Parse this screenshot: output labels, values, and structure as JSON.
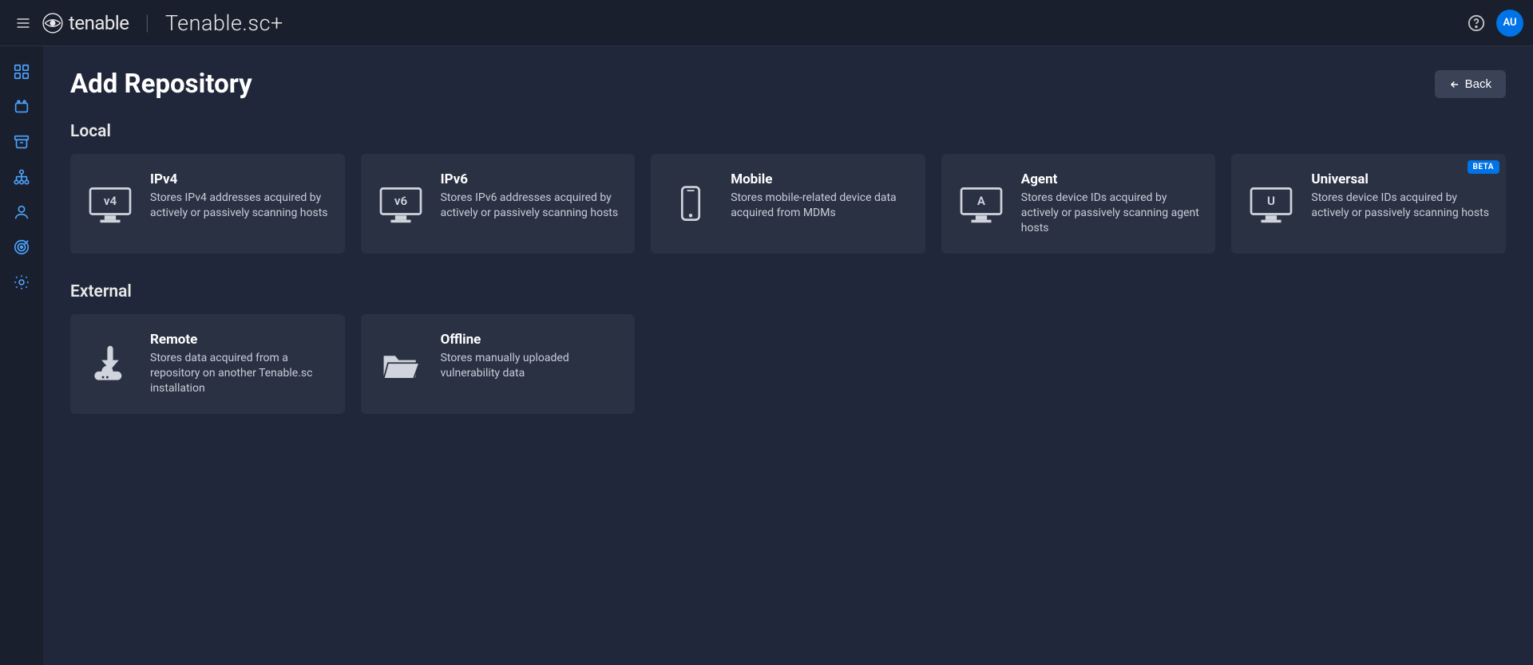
{
  "header": {
    "brand_name": "tenable",
    "product_name": "Tenable.sc+",
    "avatar_initials": "AU"
  },
  "page": {
    "title": "Add Repository",
    "back_label": "Back"
  },
  "sections": {
    "local": {
      "title": "Local",
      "cards": [
        {
          "icon_label": "v4",
          "title": "IPv4",
          "desc": "Stores IPv4 addresses acquired by actively or passively scanning hosts"
        },
        {
          "icon_label": "v6",
          "title": "IPv6",
          "desc": "Stores IPv6 addresses acquired by actively or passively scanning hosts"
        },
        {
          "icon_label": "",
          "title": "Mobile",
          "desc": "Stores mobile-related device data acquired from MDMs"
        },
        {
          "icon_label": "A",
          "title": "Agent",
          "desc": "Stores device IDs acquired by actively or passively scanning agent hosts"
        },
        {
          "icon_label": "U",
          "title": "Universal",
          "badge": "BETA",
          "desc": "Stores device IDs acquired by actively or passively scanning hosts"
        }
      ]
    },
    "external": {
      "title": "External",
      "cards": [
        {
          "title": "Remote",
          "desc": "Stores data acquired from a repository on another Tenable.sc installation"
        },
        {
          "title": "Offline",
          "desc": "Stores manually uploaded vulnerability data"
        }
      ]
    }
  }
}
